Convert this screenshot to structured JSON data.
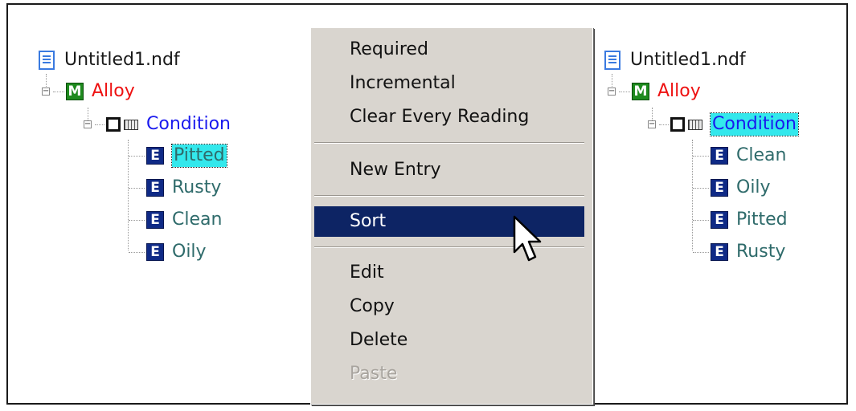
{
  "left_tree": {
    "root": {
      "label": "Untitled1.ndf",
      "icon": "document-icon"
    },
    "model": {
      "label": "Alloy",
      "icon_letter": "M"
    },
    "attribute": {
      "label": "Condition"
    },
    "entries": [
      {
        "label": "Pitted",
        "icon_letter": "E",
        "selected": true
      },
      {
        "label": "Rusty",
        "icon_letter": "E"
      },
      {
        "label": "Clean",
        "icon_letter": "E"
      },
      {
        "label": "Oily",
        "icon_letter": "E"
      }
    ]
  },
  "context_menu": {
    "items": [
      {
        "label": "Required"
      },
      {
        "label": "Incremental"
      },
      {
        "label": "Clear Every Reading"
      },
      {
        "label": "New Entry"
      },
      {
        "label": "Sort",
        "highlighted": true
      },
      {
        "label": "Edit"
      },
      {
        "label": "Copy"
      },
      {
        "label": "Delete"
      },
      {
        "label": "Paste",
        "disabled": true
      }
    ]
  },
  "right_tree": {
    "root": {
      "label": "Untitled1.ndf",
      "icon": "document-icon"
    },
    "model": {
      "label": "Alloy",
      "icon_letter": "M"
    },
    "attribute": {
      "label": "Condition",
      "selected": true
    },
    "entries": [
      {
        "label": "Clean",
        "icon_letter": "E"
      },
      {
        "label": "Oily",
        "icon_letter": "E"
      },
      {
        "label": "Pitted",
        "icon_letter": "E"
      },
      {
        "label": "Rusty",
        "icon_letter": "E"
      }
    ]
  },
  "colors": {
    "model_label": "#ee1111",
    "attribute_label": "#1a1aee",
    "entry_label": "#2f6b6b",
    "selection": "#33e8ec",
    "menu_highlight": "#0d2464",
    "menu_background": "#d9d5cf"
  }
}
